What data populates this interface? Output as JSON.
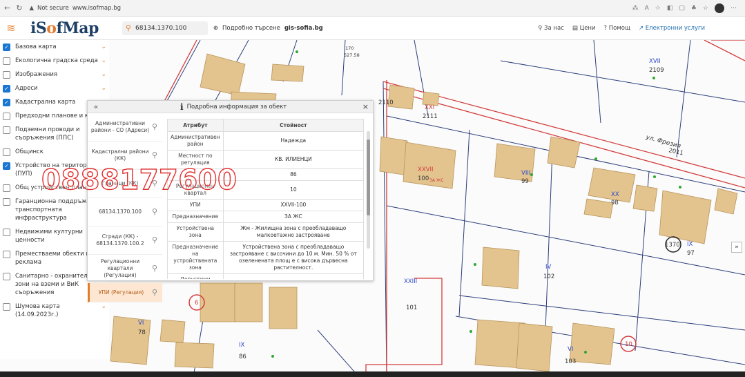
{
  "browser": {
    "security": "Not secure",
    "url": "www.isofmap.bg"
  },
  "header": {
    "logo_prefix": "iS",
    "logo_o": "o",
    "logo_suffix": "fMap",
    "search_value": "68134.1370.100",
    "advanced_search": "Подробно търсене",
    "gis_link": "gis-sofia.bg",
    "about": "За нас",
    "prices": "Цени",
    "help": "Помощ",
    "eservices": "Електронни услуги"
  },
  "sidebar": {
    "items": [
      {
        "label": "Базова карта",
        "checked": true,
        "chevron": true
      },
      {
        "label": "Екологична градска среда",
        "checked": false,
        "chevron": true
      },
      {
        "label": "Изображения",
        "checked": false,
        "chevron": true
      },
      {
        "label": "Адреси",
        "checked": true,
        "chevron": true
      },
      {
        "label": "Кадастрална карта",
        "checked": true,
        "chevron": true
      },
      {
        "label": "Предходни планове и карти",
        "checked": false,
        "chevron": false
      },
      {
        "label": "Подземни проводи и съоръжения (ППС)",
        "checked": false,
        "chevron": false
      },
      {
        "label": "Общинск",
        "checked": false,
        "chevron": false
      },
      {
        "label": "Устройство на територията (ПУП)",
        "checked": true,
        "chevron": false
      },
      {
        "label": "Общ устройствен план",
        "checked": false,
        "chevron": false
      },
      {
        "label": "Гаранционна поддръжка на транспортната инфраструктура",
        "checked": false,
        "chevron": false
      },
      {
        "label": "Недвижими културни ценности",
        "checked": false,
        "chevron": false
      },
      {
        "label": "Преместваеми обекти и реклама",
        "checked": false,
        "chevron": false
      },
      {
        "label": "Санитарно - охранителни зони на вземи и ВиК съоръжения",
        "checked": false,
        "chevron": false
      },
      {
        "label": "Шумова карта (14.09.2023г.)",
        "checked": false,
        "chevron": true
      }
    ]
  },
  "panel": {
    "collapse": "«",
    "title": "Подробна информация за обект",
    "close": "×",
    "tabs": [
      "Административни райони - СО (Адреси)",
      "Кадастрални райони (КК)",
      "Граници (КК)",
      "68134.1370.100",
      "Сгради (КК) - 68134.1370.100.2",
      "Регулационни квартали (Регулация)",
      "УПИ (Регулация)"
    ],
    "table": {
      "col_attr": "Атрибут",
      "col_value": "Стойност",
      "rows": [
        {
          "k": "Административен район",
          "v": "Надежда"
        },
        {
          "k": "Местност по регулация",
          "v": "КВ. ИЛИЕНЦИ"
        },
        {
          "k": "",
          "v": "86"
        },
        {
          "k": "Регулационен квартал",
          "v": "10"
        },
        {
          "k": "УПИ",
          "v": "XXVII-100"
        },
        {
          "k": "Предназначение",
          "v": "ЗА ЖС"
        },
        {
          "k": "Устройствена зона",
          "v": "Жм - Жилищна зона с преобладаващо малкоетажно застрояване"
        },
        {
          "k": "Предназначение на устройствената зона",
          "v": "Устройствена зона с преобладаващо застрояване с височини до 10 м. Мин. 50 % от озеленената площ е с висока дървесна растителност."
        },
        {
          "k": "Допустими",
          "v": ""
        }
      ]
    }
  },
  "watermark": "0888177600",
  "map": {
    "street": "ул. Фрезия",
    "labels": [
      {
        "text": "XXVII",
        "sub": "100",
        "zone": "ЗА ЖС"
      },
      {
        "text": "XXI",
        "sub": "2111"
      },
      {
        "text": "2110"
      },
      {
        "text": "2011"
      },
      {
        "text": "XVII",
        "sub": "2109"
      },
      {
        "text": "VIII",
        "sub": "99"
      },
      {
        "text": "XX",
        "sub": "98"
      },
      {
        "text": "IX",
        "sub": "97"
      },
      {
        "text": "1370"
      },
      {
        "text": "IV",
        "sub": "102"
      },
      {
        "text": "XXIII",
        "sub": "101"
      },
      {
        "text": "101"
      },
      {
        "text": "VI",
        "sub": "103"
      },
      {
        "text": "10"
      },
      {
        "text": "VI",
        "sub": "78"
      },
      {
        "text": "IX",
        "sub": "86"
      },
      {
        "text": "6"
      },
      {
        "text": "170",
        "sub": "527.58"
      }
    ]
  },
  "colors": {
    "accent": "#e57c2a",
    "brand": "#1d3f66",
    "checkbox": "#1976d2",
    "building": "#e3c48e",
    "building_dark": "#c9a46a",
    "parcel_line": "#2c3e7a",
    "reg_line": "#d33c3c"
  }
}
